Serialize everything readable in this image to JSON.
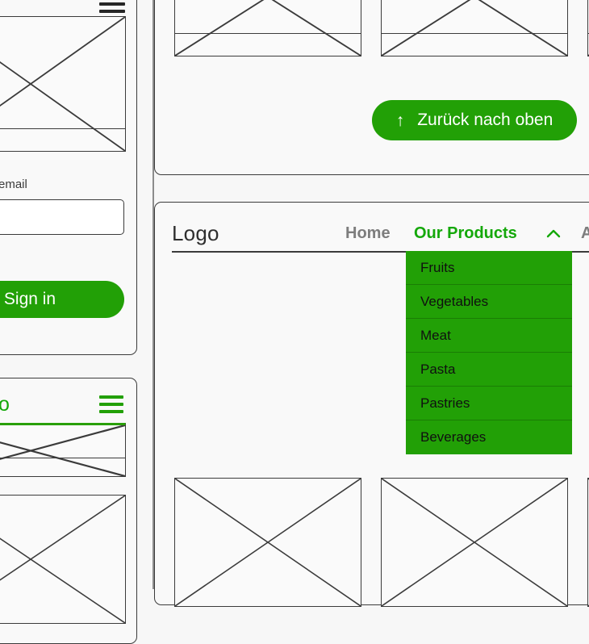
{
  "theme": {
    "brand_green": "#22a006",
    "nav_active_green": "#14a80a",
    "page_background": "#f7f7f7",
    "panel_background": "#f9f9f9",
    "outline": "#3b3b3b"
  },
  "left_column": {
    "signin_panel": {
      "menu_icon": "hamburger-menu-icon",
      "image_placeholder": "image-placeholder",
      "email_label": "email",
      "email_value": "",
      "email_placeholder": "",
      "submit_label": "Sign in"
    },
    "second_panel": {
      "logo_text": "o",
      "menu_icon": "hamburger-menu-icon",
      "image_placeholder": "image-placeholder"
    }
  },
  "right_column": {
    "top_panel": {
      "image_placeholders": [
        "image-placeholder",
        "image-placeholder",
        "image-placeholder"
      ],
      "back_to_top_button": {
        "arrow_icon": "arrow-up-icon",
        "label": "Zurück nach oben"
      }
    },
    "nav_panel": {
      "logo": "Logo",
      "links": [
        {
          "label": "Home",
          "state": "muted"
        },
        {
          "label": "Our Products",
          "state": "active",
          "chevron": "chevron-up-icon"
        },
        {
          "label": "A",
          "state": "plain"
        }
      ],
      "dropdown": {
        "open": true,
        "items": [
          "Fruits",
          "Vegetables",
          "Meat",
          "Pasta",
          "Pastries",
          "Beverages"
        ]
      },
      "content_placeholders": [
        "image-placeholder",
        "image-placeholder",
        "image-placeholder"
      ]
    }
  }
}
